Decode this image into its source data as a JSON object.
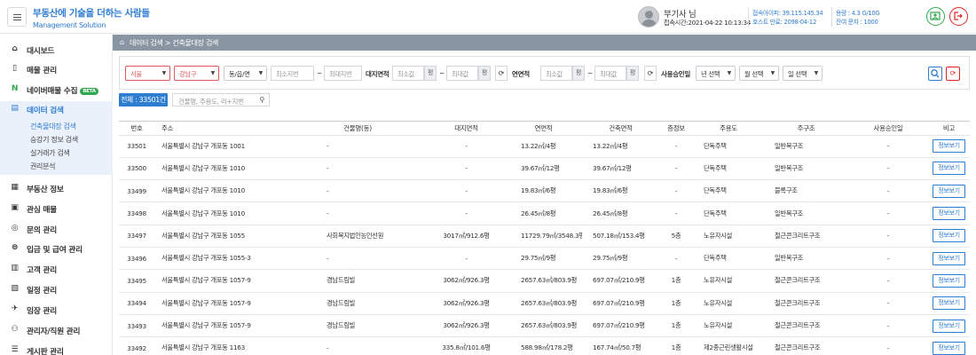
{
  "header": {
    "brand_line1": "부동산에 기술을 더하는 사람들",
    "brand_line2": "Management Solution",
    "user_name": "부기사 님",
    "login_time": "접속시간:2021-04-22 10:13:34",
    "ip_info": "접속아이피: 39.115.145.34",
    "host_expiry": "호스트 만료: 2098-04-12",
    "capacity": "용량 : 4.3 G/10G",
    "sms_remaining": "잔여 문자 : 1000",
    "colors": {
      "accent": "#2e7dd1",
      "green": "#2fa84f",
      "red": "#e02424"
    }
  },
  "sidebar": {
    "items": [
      {
        "label": "대시보드",
        "icon": "home-icon"
      },
      {
        "label": "매물 관리",
        "icon": "building-icon"
      },
      {
        "label": "네이버매물 수집",
        "icon": "naver-icon",
        "badge": "BETA"
      },
      {
        "label": "데이터 검색",
        "icon": "document-icon"
      },
      {
        "label": "부동산 정보",
        "icon": "book-icon"
      },
      {
        "label": "관심 매물",
        "icon": "bookmark-icon"
      },
      {
        "label": "문의 관리",
        "icon": "chat-icon"
      },
      {
        "label": "입금 및 급여 관리",
        "icon": "money-icon"
      },
      {
        "label": "고객 관리",
        "icon": "customers-icon"
      },
      {
        "label": "일정 관리",
        "icon": "calendar-icon"
      },
      {
        "label": "임장 관리",
        "icon": "car-icon"
      },
      {
        "label": "관리자/직원 관리",
        "icon": "staff-icon"
      },
      {
        "label": "게시판 관리",
        "icon": "list-icon"
      }
    ],
    "sub_items": [
      "건축물대장 검색",
      "승강기 정보 검색",
      "실거래가 검색",
      "권리분석"
    ]
  },
  "breadcrumb": "데이터 검색 > 건축물대장 검색",
  "filters": {
    "city": "서울",
    "district": "강남구",
    "dong": "동/읍/면",
    "min_jibun": "최소지번",
    "max_jibun": "최대지번",
    "land_area_label": "대지면적",
    "min_value": "최소값",
    "max_value": "최대값",
    "unit": "평",
    "floor_area_label": "연면적",
    "approval_label": "사용승인일",
    "year_select": "년 선택",
    "month_select": "월 선택",
    "day_select": "일 선택"
  },
  "total_count": "전체 : 33501건",
  "search_placeholder": "건물명, 주용도, 리+지번",
  "table": {
    "headers": [
      "번호",
      "주소",
      "건물명(동)",
      "대지면적",
      "연면적",
      "건축면적",
      "층정보",
      "주용도",
      "주구조",
      "사용승인일",
      "비고"
    ],
    "button_label": "정보보기",
    "rows": [
      [
        "33501",
        "서울특별시 강남구 개포동 1001",
        "-",
        "-",
        "13.22㎡/4평",
        "13.22㎡/4평",
        "-",
        "단독주택",
        "일반목구조",
        "-"
      ],
      [
        "33500",
        "서울특별시 강남구 개포동 1010",
        "-",
        "-",
        "39.67㎡/12평",
        "39.67㎡/12평",
        "-",
        "단독주택",
        "일반목구조",
        "-"
      ],
      [
        "33499",
        "서울특별시 강남구 개포동 1010",
        "-",
        "-",
        "19.83㎡/6평",
        "19.83㎡/6평",
        "-",
        "단독주택",
        "블록구조",
        "-"
      ],
      [
        "33498",
        "서울특별시 강남구 개포동 1010",
        "-",
        "-",
        "26.45㎡/8평",
        "26.45㎡/8평",
        "-",
        "단독주택",
        "일반목구조",
        "-"
      ],
      [
        "33497",
        "서울특별시 강남구 개포동 1055",
        "사회복지법인농인선원",
        "3017㎡/912.6평",
        "11729.79㎡/3548.3평",
        "507.18㎡/153.4평",
        "5층",
        "노유자시설",
        "철근콘크리트구조",
        "-"
      ],
      [
        "33496",
        "서울특별시 강남구 개포동 1055-3",
        "-",
        "-",
        "29.75㎡/9평",
        "29.75㎡/9평",
        "-",
        "단독주택",
        "일반목구조",
        "-"
      ],
      [
        "33495",
        "서울특별시 강남구 개포동 1057-9",
        "경남드림빌",
        "3062㎡/926.3평",
        "2657.63㎡/803.9평",
        "697.07㎡/210.9평",
        "1층",
        "노유자시설",
        "철근콘크리트구조",
        "-"
      ],
      [
        "33494",
        "서울특별시 강남구 개포동 1057-9",
        "경남드림빌",
        "3062㎡/926.3평",
        "2657.63㎡/803.9평",
        "697.07㎡/210.9평",
        "1층",
        "노유자시설",
        "철근콘크리트구조",
        "-"
      ],
      [
        "33493",
        "서울특별시 강남구 개포동 1057-9",
        "경남드림빌",
        "3062㎡/926.3평",
        "2657.63㎡/803.9평",
        "697.07㎡/210.9평",
        "1층",
        "노유자시설",
        "철근콘크리트구조",
        "-"
      ],
      [
        "33492",
        "서울특별시 강남구 개포동 1163",
        "-",
        "335.8㎡/101.6평",
        "588.98㎡/178.2평",
        "167.74㎡/50.7평",
        "1층",
        "제2종근린생활시설",
        "철근콘크리트구조",
        "-"
      ]
    ]
  }
}
